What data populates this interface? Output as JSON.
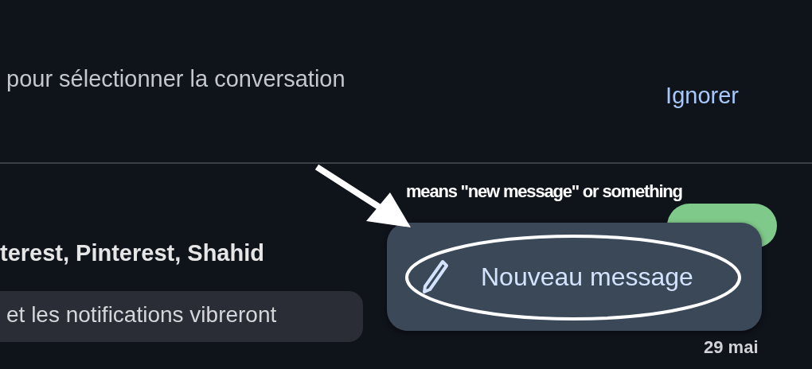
{
  "banner": {
    "text": "pour sélectionner la conversation",
    "action": "Ignorer"
  },
  "conversation": {
    "title": "terest, Pinterest, Shahid",
    "preview": "et les notifications vibreront",
    "date": "29 mai",
    "badge": {
      "color": "#7fc98a"
    }
  },
  "fab": {
    "label": "Nouveau message"
  },
  "annotation": {
    "caption": "means \"new message\" or something"
  }
}
